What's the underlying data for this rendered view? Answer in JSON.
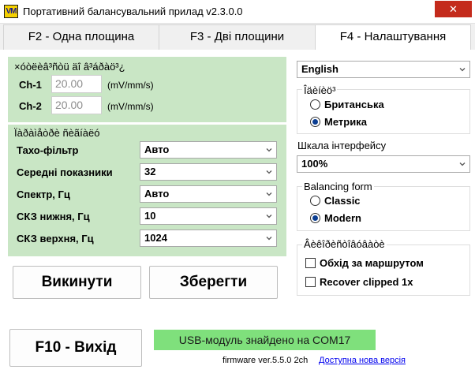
{
  "window": {
    "icon_text": "VM",
    "title": "Портативний балансувальний прилад v2.3.0.0",
    "close_glyph": "✕"
  },
  "tabs": [
    {
      "label": "F2 - Одна площина",
      "active": false
    },
    {
      "label": "F3 - Дві площини",
      "active": false
    },
    {
      "label": "F4 - Налаштування",
      "active": true
    }
  ],
  "sensitivity": {
    "caption": "×óòëèâ³ñòü äî â³áðàö³¿",
    "rows": [
      {
        "label": "Ch-1",
        "value": "20.00",
        "unit": "(mV/mm/s)"
      },
      {
        "label": "Ch-2",
        "value": "20.00",
        "unit": "(mV/mm/s)"
      }
    ]
  },
  "measurement": {
    "caption": "Ïàðàìåòðè ñèãíàëó",
    "rows": [
      {
        "label": "Тахо-фільтр",
        "value": "Авто"
      },
      {
        "label": "Середні показники",
        "value": "32"
      },
      {
        "label": "Спектр, Гц",
        "value": "Авто"
      },
      {
        "label": "СКЗ нижня, Гц",
        "value": "10"
      },
      {
        "label": "СКЗ верхня, Гц",
        "value": "1024"
      }
    ]
  },
  "actions": {
    "discard_label": "Викинути",
    "save_label": "Зберегти",
    "exit_label": "F10 - Вихід"
  },
  "language": {
    "value": "English"
  },
  "units": {
    "caption": "Îäèíèö³",
    "options": [
      {
        "label": "Британська",
        "checked": false
      },
      {
        "label": "Метрика",
        "checked": true
      }
    ]
  },
  "scale": {
    "caption": "Шкала інтерфейсу",
    "value": "100%"
  },
  "balancing_form": {
    "caption": "Balancing form",
    "options": [
      {
        "label": "Classic",
        "checked": false
      },
      {
        "label": "Modern",
        "checked": true
      }
    ]
  },
  "extra": {
    "caption": "Âèêîðèñòîâóâàòè",
    "options": [
      {
        "label": "Обхід за маршрутом",
        "checked": false
      },
      {
        "label": "Recover clipped 1x",
        "checked": false
      }
    ]
  },
  "status": {
    "usb_text": "USB-модуль знайдено на COM17",
    "usb_color": "#7fe07c",
    "firmware": "firmware ver.5.5.0 2ch",
    "update_link": "Доступна нова версія"
  }
}
